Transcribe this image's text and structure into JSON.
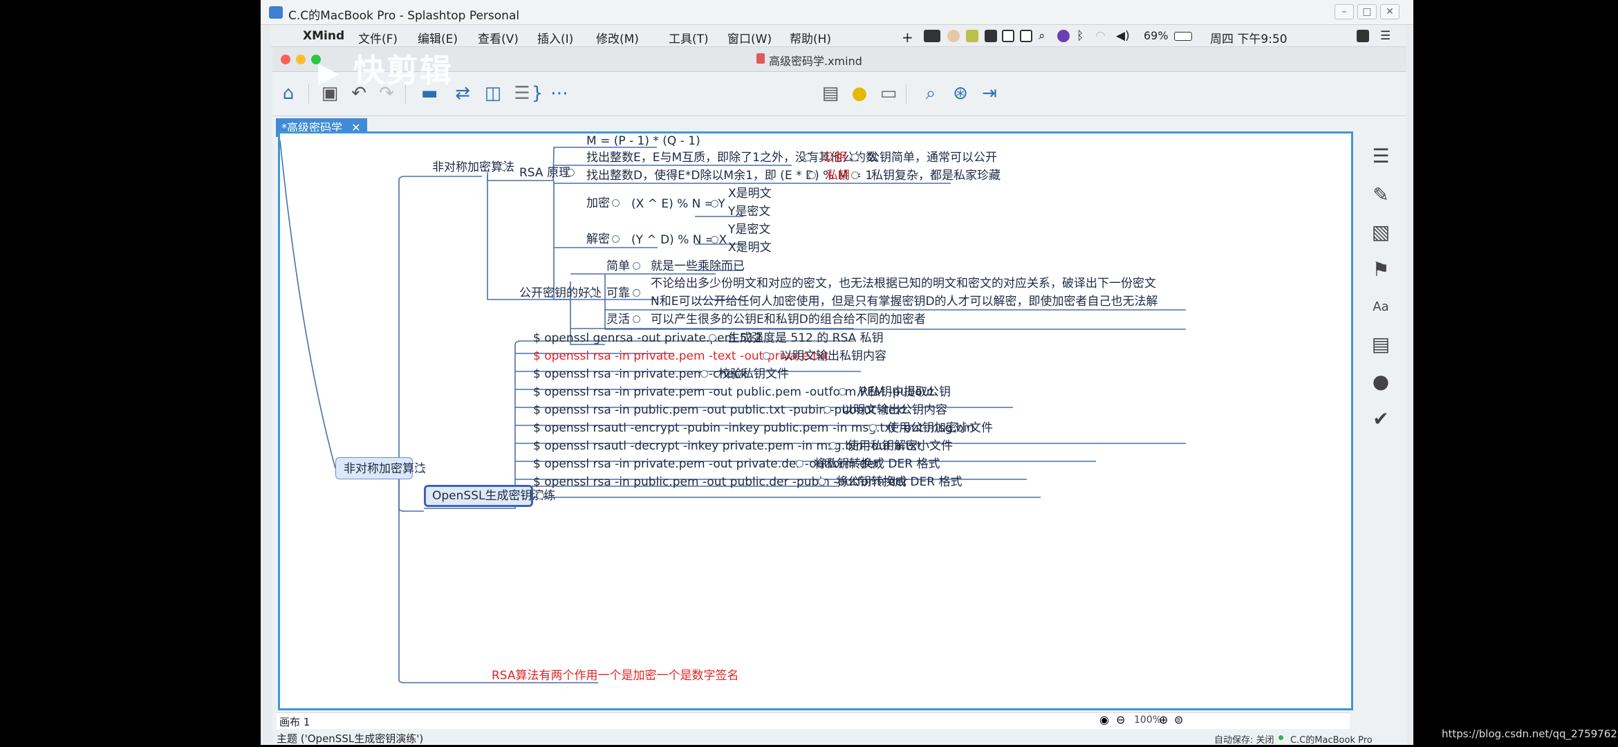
{
  "remote_title": "C.C的MacBook Pro - Splashtop Personal",
  "mac_menu": {
    "app": "XMind",
    "items": [
      "文件(F)",
      "编辑(E)",
      "查看(V)",
      "插入(I)",
      "修改(M)",
      "工具(T)",
      "窗口(W)",
      "帮助(H)"
    ],
    "battery": "69%",
    "clock": "周四 下午9:50"
  },
  "document_title": "高级密码学.xmind",
  "tab_label": "*高级密码学",
  "mindmap": {
    "root": "非对称加密算法",
    "branch1": "非对称加密算法",
    "rsa": {
      "label": "RSA 原理",
      "m": "M = (P - 1) * (Q - 1)",
      "e": "找出整数E，E与M互质，即除了1之外，没有其他公约数",
      "e_tag": "公钥",
      "e_note": "公钥简单，通常可以公开",
      "d": "找出整数D，使得E*D除以M余1，即 (E * D) % M = 1",
      "d_tag": "私钥",
      "d_note": "私钥复杂，都是私家珍藏",
      "enc": "加密",
      "enc_formula": "(X ^ E) % N = Y",
      "enc_x": "X是明文",
      "enc_y": "Y是密文",
      "dec": "解密",
      "dec_formula": "(Y ^ D) % N = X",
      "dec_y": "Y是密文",
      "dec_x": "X是明文"
    },
    "benefits": {
      "label": "公开密钥的好处",
      "simple": "简单",
      "simple_note": "就是一些乘除而已",
      "reliable": "可靠",
      "reliable_1": "不论给出多少份明文和对应的密文，也无法根据已知的明文和密文的对应关系，破译出下一份密文",
      "reliable_2": "N和E可以公开给任何人加密使用，但是只有掌握密钥D的人才可以解密，即使加密者自己也无法解",
      "flexible": "灵活",
      "flexible_note": "可以产生很多的公钥E和私钥D的组合给不同的加密者"
    },
    "openssl": {
      "label": "OpenSSL生成密钥演练",
      "commands": [
        {
          "cmd": "$ openssl genrsa -out private.pem 512",
          "note": "生成强度是 512 的 RSA 私钥"
        },
        {
          "cmd": "$ openssl rsa -in private.pem -text -out private.txt",
          "note": "以明文输出私钥内容"
        },
        {
          "cmd": "$ openssl rsa -in private.pem -check",
          "note": "校验私钥文件"
        },
        {
          "cmd": "$ openssl rsa -in private.pem -out public.pem -outform PEM -pubout",
          "note": "从私钥中提取公钥"
        },
        {
          "cmd": "$ openssl rsa -in public.pem -out public.txt -pubin -pubout -text",
          "note": "以明文输出公钥内容"
        },
        {
          "cmd": "$ openssl rsautl -encrypt -pubin -inkey public.pem -in msg.txt -out msg.bin",
          "note": "使用公钥加密小文件"
        },
        {
          "cmd": "$ openssl rsautl -decrypt -inkey private.pem -in msg.bin -out a.txt",
          "note": "使用私钥解密小文件"
        },
        {
          "cmd": "$ openssl rsa -in private.pem -out private.der -outform der",
          "note": "将私钥转换成 DER 格式"
        },
        {
          "cmd": "$ openssl rsa -in public.pem -out public.der -pubin -outform der",
          "note": "将公钥转换成 DER 格式"
        }
      ]
    },
    "rsa_note": "RSA算法有两个作用一个是加密一个是数字签名"
  },
  "canvas_tab": "画布 1",
  "zoom": "100%",
  "status_topic": "主题 ('OpenSSL生成密钥演练')",
  "autosave": "自动保存: 关闭",
  "account": "C.C的MacBook Pro",
  "watermark_text": "快剪辑",
  "csdn_url": "https://blog.csdn.net/qq_27597629",
  "colors": {
    "accent": "#3f8bd6",
    "red": "#e02424",
    "node_border": "#3a64b8"
  }
}
